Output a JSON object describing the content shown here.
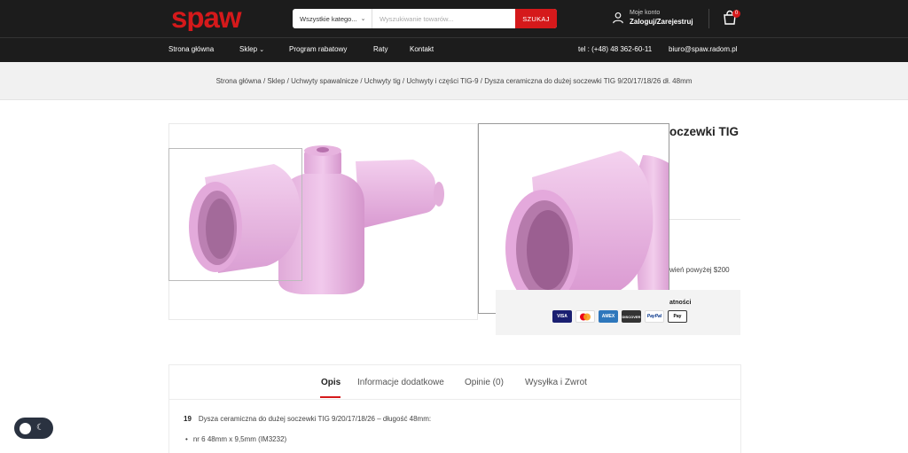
{
  "header": {
    "logo_text": "spaw",
    "search": {
      "category_label": "Wszystkie katego...",
      "placeholder": "Wyszukiwanie towarów...",
      "button_label": "SZUKAJ"
    },
    "account": {
      "line1": "Moje konto",
      "line2": "Zaloguj/Zarejestruj"
    },
    "cart_count": "0"
  },
  "nav": {
    "items": [
      {
        "label": "Strona główna"
      },
      {
        "label": "Sklep"
      },
      {
        "label": "Program rabatowy"
      },
      {
        "label": "Raty"
      },
      {
        "label": "Kontakt"
      }
    ],
    "phone": "tel : (+48) 48 362-60-11",
    "email": "biuro@spaw.radom.pl"
  },
  "breadcrumb": "Strona główna / Sklep / Uchwyty spawalnicze / Uchwyty tig / Uchwyty i części TIG-9 / Dysza ceramiczna do dużej soczewki TIG 9/20/17/18/26 dł. 48mm",
  "product": {
    "title_fragment": "oczewki TIG",
    "shipping_fragment": "wień powyżej $200",
    "payment_label_fragment": "atności",
    "payment_methods": [
      "VISA",
      "MC",
      "AMEX",
      "DISCOVER",
      "PayPal",
      "Pay"
    ]
  },
  "tabs": [
    {
      "label": "Opis"
    },
    {
      "label": "Informacje dodatkowe"
    },
    {
      "label": "Opinie (0)"
    },
    {
      "label": "Wysyłka i Zwrot"
    }
  ],
  "description": {
    "number": "19",
    "text": "Dysza ceramiczna do dużej soczewki TIG 9/20/17/18/26 – długość 48mm:",
    "bullet": "nr 6 48mm x 9,5mm (IM3232)"
  },
  "colors": {
    "brand_red": "#d5191b",
    "dark_bar": "#1c1c1c",
    "nozzle_pink": "#e7b5e0"
  }
}
